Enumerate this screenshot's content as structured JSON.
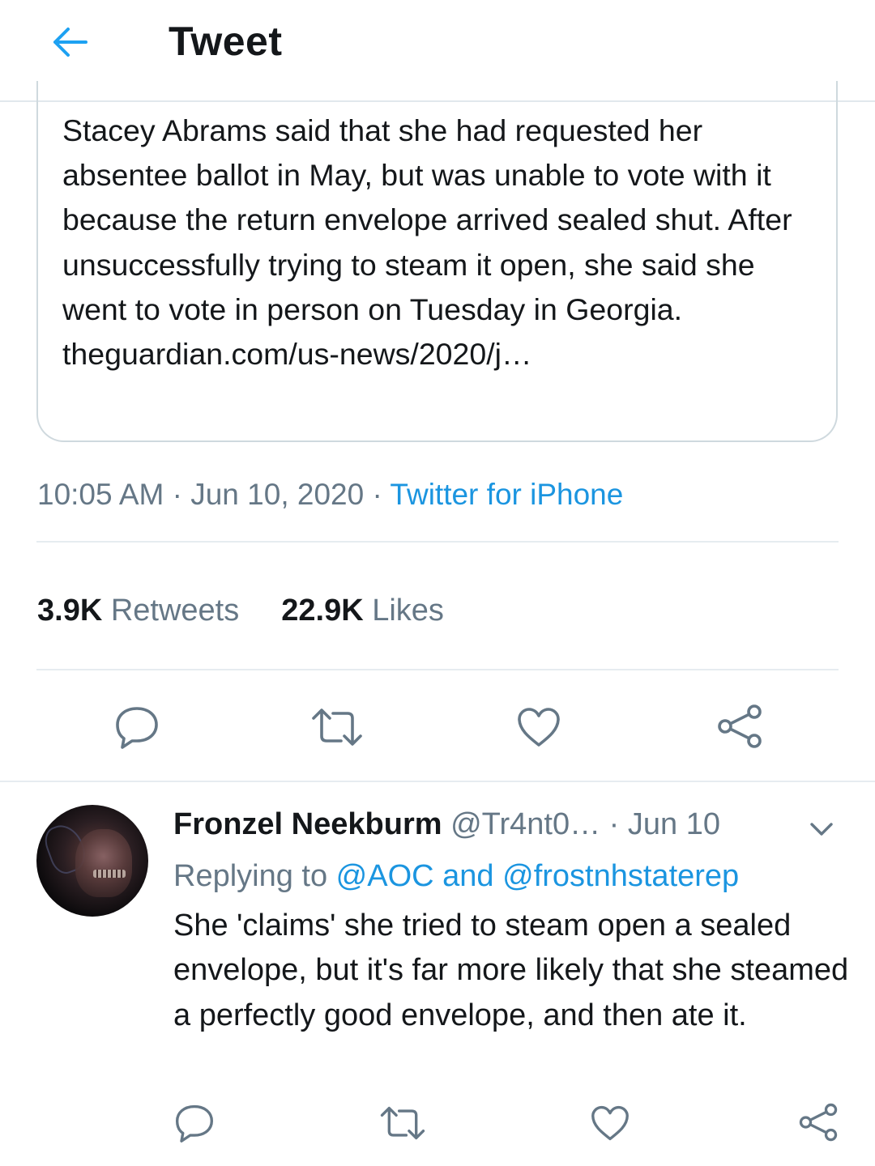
{
  "header": {
    "title": "Tweet",
    "back_icon": "arrow-left-icon",
    "accent_color": "#1da1f2"
  },
  "quoted_tweet": {
    "text": "Stacey Abrams said that she had requested her absentee ballot in May, but was unable to vote with it because the return envelope arrived sealed shut. After unsuccessfully trying to steam it open, she said she went to vote in person on Tuesday in Georgia. theguardian.com/us-news/2020/j…"
  },
  "meta": {
    "time": "10:05 AM",
    "date": "Jun 10, 2020",
    "sep1": " · ",
    "sep2": " · ",
    "source": "Twitter for iPhone"
  },
  "stats": {
    "retweets_count": "3.9K",
    "retweets_label": " Retweets",
    "likes_count": "22.9K",
    "likes_label": " Likes"
  },
  "actions": {
    "icons": [
      "reply-icon",
      "retweet-icon",
      "like-icon",
      "share-icon"
    ]
  },
  "reply": {
    "name": "Fronzel Neekburm",
    "handle": "@Tr4nt0…",
    "date_sep": " · ",
    "date": "Jun 10",
    "replying_prefix": "Replying to ",
    "mention1": "@AOC",
    "mention_and": " and ",
    "mention2": "@frostnhstaterep",
    "text": "She 'claims' she tried to steam open a sealed envelope, but it's far more likely that she steamed a perfectly good envelope, and then ate it."
  },
  "colors": {
    "link": "#1b95e0",
    "secondary_text": "#657786",
    "icon": "#657786",
    "divider": "#e6ecf0"
  }
}
